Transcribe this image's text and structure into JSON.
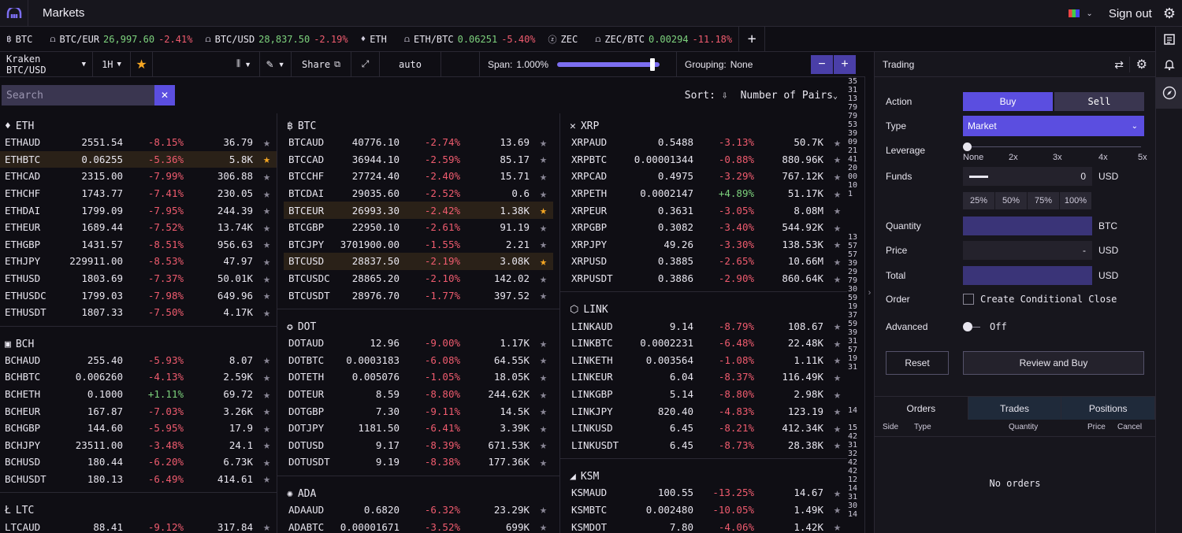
{
  "app": {
    "title": "Markets",
    "signout": "Sign out"
  },
  "tickers": [
    {
      "sym": "BTC",
      "icon": "btc-icon"
    },
    {
      "sym": "BTC/EUR",
      "price": "26,997.60",
      "chg": "-2.41%",
      "icon": "kraken-icon"
    },
    {
      "sym": "BTC/USD",
      "price": "28,837.50",
      "chg": "-2.19%",
      "icon": "kraken-icon"
    },
    {
      "sym": "ETH",
      "icon": "eth-icon"
    },
    {
      "sym": "ETH/BTC",
      "price": "0.06251",
      "chg": "-5.40%",
      "icon": "kraken-icon"
    },
    {
      "sym": "ZEC",
      "icon": "zec-icon"
    },
    {
      "sym": "ZEC/BTC",
      "price": "0.00294",
      "chg": "-11.18%",
      "icon": "kraken-icon"
    }
  ],
  "toolbar": {
    "pair": "Kraken BTC/USD",
    "interval": "1H",
    "share": "Share",
    "auto": "auto",
    "span_label": "Span:",
    "span_value": "1.000%",
    "span_fill": 0.93,
    "grouping_label": "Grouping:",
    "grouping_value": "None"
  },
  "search": {
    "placeholder": "Search"
  },
  "sort": {
    "label": "Sort:",
    "value": "Number of Pairs"
  },
  "groups": [
    {
      "col": 1,
      "name": "ETH",
      "icon": "eth-icon",
      "rows": [
        [
          "ETHAUD",
          "2551.54",
          "-8.15%",
          "36.79",
          false,
          false
        ],
        [
          "ETHBTC",
          "0.06255",
          "-5.36%",
          "5.8K",
          true,
          true
        ],
        [
          "ETHCAD",
          "2315.00",
          "-7.99%",
          "306.88",
          false,
          false
        ],
        [
          "ETHCHF",
          "1743.77",
          "-7.41%",
          "230.05",
          false,
          false
        ],
        [
          "ETHDAI",
          "1799.09",
          "-7.95%",
          "244.39",
          false,
          false
        ],
        [
          "ETHEUR",
          "1689.44",
          "-7.52%",
          "13.74K",
          false,
          false
        ],
        [
          "ETHGBP",
          "1431.57",
          "-8.51%",
          "956.63",
          false,
          false
        ],
        [
          "ETHJPY",
          "229911.00",
          "-8.53%",
          "47.97",
          false,
          false
        ],
        [
          "ETHUSD",
          "1803.69",
          "-7.37%",
          "50.01K",
          false,
          false
        ],
        [
          "ETHUSDC",
          "1799.03",
          "-7.98%",
          "649.96",
          false,
          false
        ],
        [
          "ETHUSDT",
          "1807.33",
          "-7.50%",
          "4.17K",
          false,
          false
        ]
      ]
    },
    {
      "col": 1,
      "name": "BCH",
      "icon": "bch-icon",
      "rows": [
        [
          "BCHAUD",
          "255.40",
          "-5.93%",
          "8.07",
          false,
          false
        ],
        [
          "BCHBTC",
          "0.006260",
          "-4.13%",
          "2.59K",
          false,
          false
        ],
        [
          "BCHETH",
          "0.1000",
          "+1.11%",
          "69.72",
          false,
          false
        ],
        [
          "BCHEUR",
          "167.87",
          "-7.03%",
          "3.26K",
          false,
          false
        ],
        [
          "BCHGBP",
          "144.60",
          "-5.95%",
          "17.9",
          false,
          false
        ],
        [
          "BCHJPY",
          "23511.00",
          "-3.48%",
          "24.1",
          false,
          false
        ],
        [
          "BCHUSD",
          "180.44",
          "-6.20%",
          "6.73K",
          false,
          false
        ],
        [
          "BCHUSDT",
          "180.13",
          "-6.49%",
          "414.61",
          false,
          false
        ]
      ]
    },
    {
      "col": 1,
      "name": "LTC",
      "icon": "ltc-icon",
      "rows": [
        [
          "LTCAUD",
          "88.41",
          "-9.12%",
          "317.84",
          false,
          false
        ]
      ]
    },
    {
      "col": 2,
      "name": "BTC",
      "icon": "btc-icon",
      "rows": [
        [
          "BTCAUD",
          "40776.10",
          "-2.74%",
          "13.69",
          false,
          false
        ],
        [
          "BTCCAD",
          "36944.10",
          "-2.59%",
          "85.17",
          false,
          false
        ],
        [
          "BTCCHF",
          "27724.40",
          "-2.40%",
          "15.71",
          false,
          false
        ],
        [
          "BTCDAI",
          "29035.60",
          "-2.52%",
          "0.6",
          false,
          false
        ],
        [
          "BTCEUR",
          "26993.30",
          "-2.42%",
          "1.38K",
          true,
          true
        ],
        [
          "BTCGBP",
          "22950.10",
          "-2.61%",
          "91.19",
          false,
          false
        ],
        [
          "BTCJPY",
          "3701900.00",
          "-1.55%",
          "2.21",
          false,
          false
        ],
        [
          "BTCUSD",
          "28837.50",
          "-2.19%",
          "3.08K",
          true,
          true
        ],
        [
          "BTCUSDC",
          "28865.20",
          "-2.10%",
          "142.02",
          false,
          false
        ],
        [
          "BTCUSDT",
          "28976.70",
          "-1.77%",
          "397.52",
          false,
          false
        ]
      ]
    },
    {
      "col": 2,
      "name": "DOT",
      "icon": "dot-icon",
      "rows": [
        [
          "DOTAUD",
          "12.96",
          "-9.00%",
          "1.17K",
          false,
          false
        ],
        [
          "DOTBTC",
          "0.0003183",
          "-6.08%",
          "64.55K",
          false,
          false
        ],
        [
          "DOTETH",
          "0.005076",
          "-1.05%",
          "18.05K",
          false,
          false
        ],
        [
          "DOTEUR",
          "8.59",
          "-8.80%",
          "244.62K",
          false,
          false
        ],
        [
          "DOTGBP",
          "7.30",
          "-9.11%",
          "14.5K",
          false,
          false
        ],
        [
          "DOTJPY",
          "1181.50",
          "-6.41%",
          "3.39K",
          false,
          false
        ],
        [
          "DOTUSD",
          "9.17",
          "-8.39%",
          "671.53K",
          false,
          false
        ],
        [
          "DOTUSDT",
          "9.19",
          "-8.38%",
          "177.36K",
          false,
          false
        ]
      ]
    },
    {
      "col": 2,
      "name": "ADA",
      "icon": "ada-icon",
      "rows": [
        [
          "ADAAUD",
          "0.6820",
          "-6.32%",
          "23.29K",
          false,
          false
        ],
        [
          "ADABTC",
          "0.00001671",
          "-3.52%",
          "699K",
          false,
          false
        ]
      ]
    },
    {
      "col": 3,
      "name": "XRP",
      "icon": "xrp-icon",
      "rows": [
        [
          "XRPAUD",
          "0.5488",
          "-3.13%",
          "50.7K",
          false,
          false
        ],
        [
          "XRPBTC",
          "0.00001344",
          "-0.88%",
          "880.96K",
          false,
          false
        ],
        [
          "XRPCAD",
          "0.4975",
          "-3.29%",
          "767.12K",
          false,
          false
        ],
        [
          "XRPETH",
          "0.0002147",
          "+4.89%",
          "51.17K",
          false,
          false
        ],
        [
          "XRPEUR",
          "0.3631",
          "-3.05%",
          "8.08M",
          false,
          false
        ],
        [
          "XRPGBP",
          "0.3082",
          "-3.40%",
          "544.92K",
          false,
          false
        ],
        [
          "XRPJPY",
          "49.26",
          "-3.30%",
          "138.53K",
          false,
          false
        ],
        [
          "XRPUSD",
          "0.3885",
          "-2.65%",
          "10.66M",
          false,
          false
        ],
        [
          "XRPUSDT",
          "0.3886",
          "-2.90%",
          "860.64K",
          false,
          false
        ]
      ]
    },
    {
      "col": 3,
      "name": "LINK",
      "icon": "link-icon",
      "rows": [
        [
          "LINKAUD",
          "9.14",
          "-8.79%",
          "108.67",
          false,
          false
        ],
        [
          "LINKBTC",
          "0.0002231",
          "-6.48%",
          "22.48K",
          false,
          false
        ],
        [
          "LINKETH",
          "0.003564",
          "-1.08%",
          "1.11K",
          false,
          false
        ],
        [
          "LINKEUR",
          "6.04",
          "-8.37%",
          "116.49K",
          false,
          false
        ],
        [
          "LINKGBP",
          "5.14",
          "-8.80%",
          "2.98K",
          false,
          false
        ],
        [
          "LINKJPY",
          "820.40",
          "-4.83%",
          "123.19",
          false,
          false
        ],
        [
          "LINKUSD",
          "6.45",
          "-8.21%",
          "412.34K",
          false,
          false
        ],
        [
          "LINKUSDT",
          "6.45",
          "-8.73%",
          "28.38K",
          false,
          false
        ]
      ]
    },
    {
      "col": 3,
      "name": "KSM",
      "icon": "ksm-icon",
      "rows": [
        [
          "KSMAUD",
          "100.55",
          "-13.25%",
          "14.67",
          false,
          false
        ],
        [
          "KSMBTC",
          "0.002480",
          "-10.05%",
          "1.49K",
          false,
          false
        ],
        [
          "KSMDOT",
          "7.80",
          "-4.06%",
          "1.42K",
          false,
          false
        ]
      ]
    }
  ],
  "strip_numbers": [
    "35",
    "31",
    "13",
    "79",
    "79",
    "53",
    "39",
    "09",
    "21",
    "41",
    "20",
    "00",
    "10",
    "1",
    "",
    "",
    "",
    "",
    "13",
    "57",
    "57",
    "39",
    "29",
    "79",
    "30",
    "59",
    "19",
    "37",
    "59",
    "39",
    "31",
    "57",
    "19",
    "31",
    "",
    "",
    "",
    "",
    "14",
    "",
    "15",
    "42",
    "31",
    "32",
    "42",
    "42",
    "12",
    "14",
    "31",
    "30",
    "14"
  ],
  "trading": {
    "title": "Trading",
    "action_label": "Action",
    "buy": "Buy",
    "sell": "Sell",
    "type_label": "Type",
    "type_value": "Market",
    "leverage_label": "Leverage",
    "leverage_ticks": [
      "None",
      "2x",
      "3x",
      "4x",
      "5x"
    ],
    "funds_label": "Funds",
    "funds_value": "0",
    "funds_unit": "USD",
    "pcts": [
      "25%",
      "50%",
      "75%",
      "100%"
    ],
    "quantity_label": "Quantity",
    "quantity_unit": "BTC",
    "price_label": "Price",
    "price_value": "-",
    "price_unit": "USD",
    "total_label": "Total",
    "total_unit": "USD",
    "order_label": "Order",
    "order_check": "Create Conditional Close",
    "advanced_label": "Advanced",
    "advanced_value": "Off",
    "reset": "Reset",
    "review": "Review and Buy",
    "tabs": [
      "Orders",
      "Trades",
      "Positions"
    ],
    "columns": [
      "Side",
      "Type",
      "Quantity",
      "Price",
      "Cancel"
    ],
    "empty": "No orders"
  },
  "colors": {
    "accent": "#5b4ee0",
    "positive": "#7dd27d",
    "negative": "#ef5b6e",
    "star": "#f5a623"
  }
}
